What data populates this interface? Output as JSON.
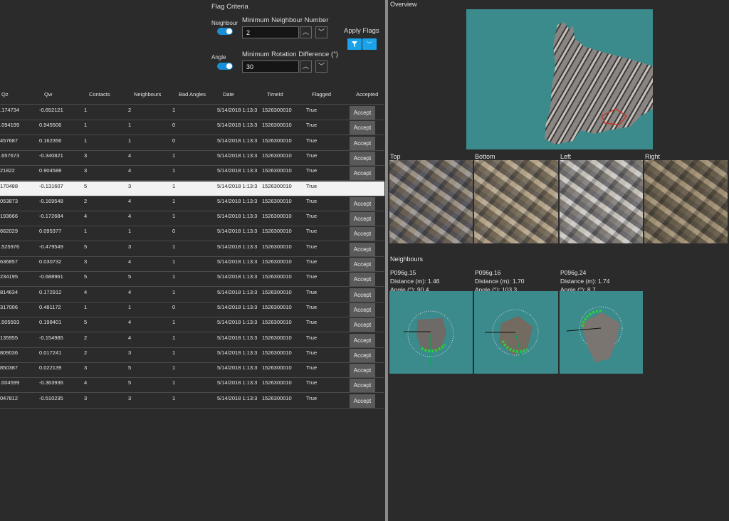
{
  "flag_criteria": {
    "title": "Flag Criteria",
    "neighbour_toggle_label": "Neighbour",
    "angle_toggle_label": "Angle",
    "min_neighbour_label": "Minimum Neighbour Number",
    "min_neighbour_value": "2",
    "min_rotation_label": "Minimum Rotation Difference (°)",
    "min_rotation_value": "30",
    "apply_flags_label": "Apply Flags"
  },
  "table": {
    "columns": [
      "Qz",
      "Qw",
      "Contacts",
      "Neighbours",
      "Bad Angles",
      "Date",
      "TimeId",
      "Flagged",
      "Accepted"
    ],
    "accept_label": "Accept",
    "rows": [
      {
        "qz": ".174734",
        "qw": "-0.652121",
        "contacts": "1",
        "neighbours": "2",
        "bad": "1",
        "date": "5/14/2018 1:13:3",
        "timeid": "1526300010",
        "flagged": "True",
        "accept": true
      },
      {
        "qz": ".094199",
        "qw": "0.945506",
        "contacts": "1",
        "neighbours": "1",
        "bad": "0",
        "date": "5/14/2018 1:13:3",
        "timeid": "1526300010",
        "flagged": "True",
        "accept": true
      },
      {
        "qz": "457687",
        "qw": "0.162356",
        "contacts": "1",
        "neighbours": "1",
        "bad": "0",
        "date": "5/14/2018 1:13:3",
        "timeid": "1526300010",
        "flagged": "True",
        "accept": true
      },
      {
        "qz": ".657673",
        "qw": "-0.340821",
        "contacts": "3",
        "neighbours": "4",
        "bad": "1",
        "date": "5/14/2018 1:13:3",
        "timeid": "1526300010",
        "flagged": "True",
        "accept": true
      },
      {
        "qz": "21822",
        "qw": "0.904588",
        "contacts": "3",
        "neighbours": "4",
        "bad": "1",
        "date": "5/14/2018 1:13:3",
        "timeid": "1526300010",
        "flagged": "True",
        "accept": true
      },
      {
        "qz": "170488",
        "qw": "-0.131607",
        "contacts": "5",
        "neighbours": "3",
        "bad": "1",
        "date": "5/14/2018 1:13:3",
        "timeid": "1526300010",
        "flagged": "True",
        "accept": false,
        "selected": true
      },
      {
        "qz": "053873",
        "qw": "-0.169548",
        "contacts": "2",
        "neighbours": "4",
        "bad": "1",
        "date": "5/14/2018 1:13:3",
        "timeid": "1526300010",
        "flagged": "True",
        "accept": true
      },
      {
        "qz": "193666",
        "qw": "-0.172684",
        "contacts": "4",
        "neighbours": "4",
        "bad": "1",
        "date": "5/14/2018 1:13:3",
        "timeid": "1526300010",
        "flagged": "True",
        "accept": true
      },
      {
        "qz": "662029",
        "qw": "0.095377",
        "contacts": "1",
        "neighbours": "1",
        "bad": "0",
        "date": "5/14/2018 1:13:3",
        "timeid": "1526300010",
        "flagged": "True",
        "accept": true
      },
      {
        "qz": ".525976",
        "qw": "-0.479549",
        "contacts": "5",
        "neighbours": "3",
        "bad": "1",
        "date": "5/14/2018 1:13:3",
        "timeid": "1526300010",
        "flagged": "True",
        "accept": true
      },
      {
        "qz": "636857",
        "qw": "0.030732",
        "contacts": "3",
        "neighbours": "4",
        "bad": "1",
        "date": "5/14/2018 1:13:3",
        "timeid": "1526300010",
        "flagged": "True",
        "accept": true
      },
      {
        "qz": "234195",
        "qw": "-0.688961",
        "contacts": "5",
        "neighbours": "5",
        "bad": "1",
        "date": "5/14/2018 1:13:3",
        "timeid": "1526300010",
        "flagged": "True",
        "accept": true
      },
      {
        "qz": "814634",
        "qw": "0.172912",
        "contacts": "4",
        "neighbours": "4",
        "bad": "1",
        "date": "5/14/2018 1:13:3",
        "timeid": "1526300010",
        "flagged": "True",
        "accept": true
      },
      {
        "qz": "317006",
        "qw": "0.481172",
        "contacts": "1",
        "neighbours": "1",
        "bad": "0",
        "date": "5/14/2018 1:13:3",
        "timeid": "1526300010",
        "flagged": "True",
        "accept": true
      },
      {
        "qz": ".505593",
        "qw": "0.198401",
        "contacts": "5",
        "neighbours": "4",
        "bad": "1",
        "date": "5/14/2018 1:13:3",
        "timeid": "1526300010",
        "flagged": "True",
        "accept": true
      },
      {
        "qz": "135955",
        "qw": "-0.154985",
        "contacts": "2",
        "neighbours": "4",
        "bad": "1",
        "date": "5/14/2018 1:13:3",
        "timeid": "1526300010",
        "flagged": "True",
        "accept": true
      },
      {
        "qz": "809036",
        "qw": "0.017241",
        "contacts": "2",
        "neighbours": "3",
        "bad": "1",
        "date": "5/14/2018 1:13:3",
        "timeid": "1526300010",
        "flagged": "True",
        "accept": true
      },
      {
        "qz": "850387",
        "qw": "0.022139",
        "contacts": "3",
        "neighbours": "5",
        "bad": "1",
        "date": "5/14/2018 1:13:3",
        "timeid": "1526300010",
        "flagged": "True",
        "accept": true
      },
      {
        "qz": ".004599",
        "qw": "-0.363936",
        "contacts": "4",
        "neighbours": "5",
        "bad": "1",
        "date": "5/14/2018 1:13:3",
        "timeid": "1526300010",
        "flagged": "True",
        "accept": true
      },
      {
        "qz": "047812",
        "qw": "-0.510235",
        "contacts": "3",
        "neighbours": "3",
        "bad": "1",
        "date": "5/14/2018 1:13:3",
        "timeid": "1526300010",
        "flagged": "True",
        "accept": true
      }
    ]
  },
  "overview": {
    "title": "Overview"
  },
  "views": {
    "top": "Top",
    "bottom": "Bottom",
    "left": "Left",
    "right": "Right"
  },
  "neighbours": {
    "title": "Neighbours",
    "items": [
      {
        "id": "P096g.15",
        "distance": "Distance (m): 1.46",
        "angle": "Angle (°): 90.4"
      },
      {
        "id": "P096g.16",
        "distance": "Distance (m): 1.70",
        "angle": "Angle (°): 103.3"
      },
      {
        "id": "P096g.24",
        "distance": "Distance (m): 1.74",
        "angle": "Angle (°): 8.7"
      }
    ]
  },
  "colors": {
    "accent": "#1aa3e8",
    "viewport_bg": "#3b8a8c",
    "app_bg": "#2b2b2b"
  }
}
